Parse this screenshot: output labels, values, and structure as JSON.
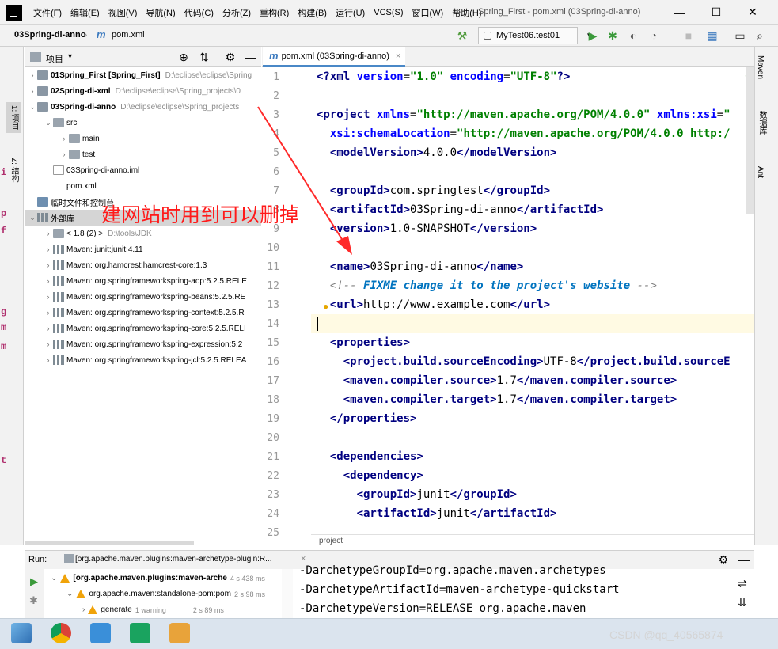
{
  "menubar": {
    "items": [
      "文件(F)",
      "编辑(E)",
      "视图(V)",
      "导航(N)",
      "代码(C)",
      "分析(Z)",
      "重构(R)",
      "构建(B)",
      "运行(U)",
      "VCS(S)",
      "窗口(W)",
      "帮助(H)"
    ],
    "window_title": "Spring_First - pom.xml (03Spring-di-anno)",
    "minimize": "—",
    "maximize": "☐",
    "close": "✕"
  },
  "navbar": {
    "project": "03Spring-di-anno",
    "separator": "›",
    "file_icon": "m",
    "file": "pom.xml",
    "run_config": "MyTest06.test01",
    "run_config_caret": "▾"
  },
  "left_strip": {
    "project_tab": "1: 项目",
    "structure_tab": "Z: 结构"
  },
  "project_panel": {
    "title": "项目",
    "caret": "▾",
    "tree": [
      {
        "arrow": "›",
        "name": "01Spring_First",
        "extra": "[Spring_First]",
        "path": "D:\\eclipse\\eclipse\\Spring",
        "icon": "module"
      },
      {
        "arrow": "›",
        "name": "02Spring-di-xml",
        "extra": "",
        "path": "D:\\eclipse\\eclipse\\Spring_projects\\0",
        "icon": "module"
      },
      {
        "arrow": "⌄",
        "name": "03Spring-di-anno",
        "extra": "",
        "path": "D:\\eclipse\\eclipse\\Spring_projects",
        "icon": "module"
      },
      {
        "arrow": "⌄",
        "name": "src",
        "extra": "",
        "path": "",
        "icon": "folder"
      },
      {
        "arrow": "›",
        "name": "main",
        "extra": "",
        "path": "",
        "icon": "folder"
      },
      {
        "arrow": "›",
        "name": "test",
        "extra": "",
        "path": "",
        "icon": "folder"
      },
      {
        "arrow": "",
        "name": "03Spring-di-anno.iml",
        "extra": "",
        "path": "",
        "icon": "file"
      },
      {
        "arrow": "",
        "name": "pom.xml",
        "extra": "",
        "path": "",
        "icon": "maven"
      },
      {
        "arrow": "",
        "name": "临时文件和控制台",
        "extra": "",
        "path": "",
        "icon": "scratch"
      },
      {
        "arrow": "⌄",
        "name": "外部库",
        "extra": "",
        "path": "",
        "icon": "lib"
      },
      {
        "arrow": "›",
        "name": "< 1.8 (2) >",
        "extra": "",
        "path": "D:\\tools\\JDK",
        "icon": "folder"
      },
      {
        "arrow": "›",
        "name": "Maven: junit:junit:4.11",
        "extra": "",
        "path": "",
        "icon": "lib"
      },
      {
        "arrow": "›",
        "name": "Maven: org.hamcrest:hamcrest-core:1.3",
        "extra": "",
        "path": "",
        "icon": "lib"
      },
      {
        "arrow": "›",
        "name": "Maven: org.springframeworkspring-aop:5.2.5.RELE",
        "extra": "",
        "path": "",
        "icon": "lib"
      },
      {
        "arrow": "›",
        "name": "Maven: org.springframeworkspring-beans:5.2.5.RE",
        "extra": "",
        "path": "",
        "icon": "lib"
      },
      {
        "arrow": "›",
        "name": "Maven: org.springframeworkspring-context:5.2.5.R",
        "extra": "",
        "path": "",
        "icon": "lib"
      },
      {
        "arrow": "›",
        "name": "Maven: org.springframeworkspring-core:5.2.5.RELI",
        "extra": "",
        "path": "",
        "icon": "lib"
      },
      {
        "arrow": "›",
        "name": "Maven: org.springframeworkspring-expression:5.2",
        "extra": "",
        "path": "",
        "icon": "lib"
      },
      {
        "arrow": "›",
        "name": "Maven: org.springframeworkspring-jcl:5.2.5.RELEA",
        "extra": "",
        "path": "",
        "icon": "lib"
      }
    ]
  },
  "annotation": "建网站时用到可以删掉",
  "editor": {
    "tab_icon": "m",
    "tab_label": "pom.xml (03Spring-di-anno)",
    "tab_close": "×",
    "breadcrumb": "project",
    "line_numbers": [
      "1",
      "2",
      "3",
      "4",
      "5",
      "6",
      "7",
      "8",
      "9",
      "10",
      "11",
      "12",
      "13",
      "14",
      "15",
      "16",
      "17",
      "18",
      "19",
      "20",
      "21",
      "22",
      "23",
      "24",
      "25"
    ]
  },
  "right_strip": {
    "maven": "Maven",
    "database": "数据库",
    "ant": "Ant"
  },
  "run_panel": {
    "label": "Run:",
    "tab": "[org.apache.maven.plugins:maven-archetype-plugin:R...",
    "tab_close": "×",
    "tree": [
      {
        "text": "[org.apache.maven.plugins:maven-arche",
        "time": "4 s 438 ms"
      },
      {
        "text": "org.apache.maven:standalone-pom:pom",
        "time": "2 s 98 ms"
      },
      {
        "text": "generate",
        "note": "1 warning",
        "time": "2 s 89 ms"
      }
    ],
    "console": [
      "-DarchetypeGroupId=org.apache.maven.archetypes",
      "-DarchetypeArtifactId=maven-archetype-quickstart",
      "-DarchetypeVersion=RELEASE org.apache.maven"
    ]
  },
  "watermark": "CSDN @qq_40565874"
}
